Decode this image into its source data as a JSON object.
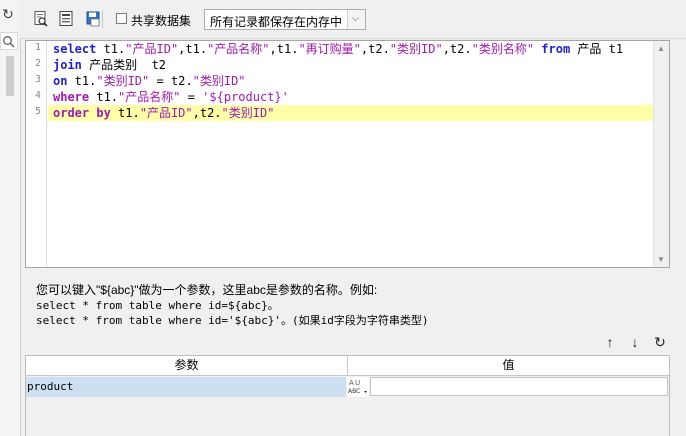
{
  "toolbar": {
    "share_dataset_label": "共享数据集",
    "memory_combo_value": "所有记录都保存在内存中"
  },
  "editor": {
    "line_numbers": [
      "1",
      "2",
      "3",
      "4",
      "5"
    ],
    "lines": [
      "select t1.\"产品ID\",t1.\"产品名称\",t1.\"再订购量\",t2.\"类别ID\",t2.\"类别名称\" from 产品 t1",
      "join 产品类别  t2",
      "on t1.\"类别ID\" = t2.\"类别ID\"",
      "where t1.\"产品名称\" = '${product}'",
      "order by t1.\"产品ID\",t2.\"类别ID\""
    ],
    "highlighted_line": 5
  },
  "hint": {
    "line1": "您可以键入\"${abc}\"做为一个参数，这里abc是参数的名称。例如:",
    "line2": "select * from table where id=${abc}。",
    "line3": "select * from table where id='${abc}'。(如果id字段为字符串类型)"
  },
  "params": {
    "col_param": "参数",
    "col_value": "值",
    "rows": [
      {
        "name": "product",
        "type_icon_text": "ABC",
        "value": ""
      }
    ]
  },
  "icons": {
    "left_refresh": "refresh-icon",
    "left_search": "search-icon",
    "preview": "preview-icon",
    "print_preview": "document-icon",
    "save": "save-icon",
    "move_up": "arrow-up-icon",
    "move_down": "arrow-down-icon",
    "refresh": "refresh-icon"
  }
}
